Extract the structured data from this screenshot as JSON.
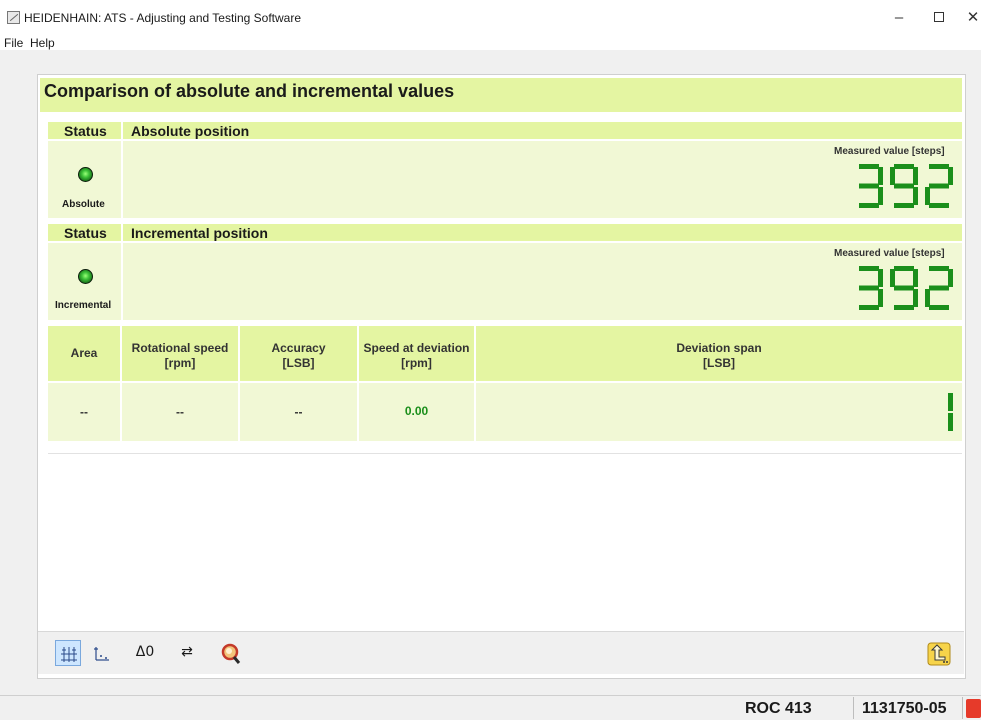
{
  "window": {
    "title": "HEIDENHAIN: ATS - Adjusting and Testing Software",
    "minimize_glyph": "–",
    "close_glyph": "✕"
  },
  "menu": {
    "file": "File",
    "help": "Help"
  },
  "page": {
    "heading": "Comparison of absolute and incremental values"
  },
  "absolute": {
    "status_header": "Status",
    "title": "Absolute position",
    "status_label": "Absolute",
    "measured_label": "Measured value [steps]",
    "value": "392",
    "led_color": "#3fc43a"
  },
  "incremental": {
    "status_header": "Status",
    "title": "Incremental position",
    "status_label": "Incremental",
    "measured_label": "Measured value [steps]",
    "value": "392",
    "led_color": "#3fc43a"
  },
  "table": {
    "columns": [
      {
        "line1": "Area",
        "line2": ""
      },
      {
        "line1": "Rotational speed",
        "line2": "[rpm]"
      },
      {
        "line1": "Accuracy",
        "line2": "[LSB]"
      },
      {
        "line1": "Speed at deviation",
        "line2": "[rpm]"
      },
      {
        "line1": "Deviation span",
        "line2": "[LSB]"
      }
    ],
    "row": {
      "area": "--",
      "rotational_speed": "--",
      "accuracy": "--",
      "speed_at_deviation": "0.00",
      "deviation_span": "1"
    }
  },
  "toolbar": {
    "buttons": [
      {
        "icon": "grid-view-icon",
        "glyph": "⌗",
        "active": true
      },
      {
        "icon": "axis-chart-icon",
        "glyph": "∟",
        "active": false
      },
      {
        "icon": "delta-zero-icon",
        "glyph": "Δ0",
        "active": false
      },
      {
        "icon": "exchange-arrows-icon",
        "glyph": "⇄",
        "active": false
      },
      {
        "icon": "magnifier-search-icon",
        "glyph": "",
        "active": false
      },
      {
        "icon": "return-arrow-icon",
        "glyph": "",
        "active": false
      }
    ]
  },
  "statusbar": {
    "device": "ROC 413",
    "id": "1131750-05"
  },
  "colors": {
    "panel_header": "#e4f5a2",
    "panel_body": "#f1f8d5",
    "segment_on": "#1b8f1b",
    "value_green": "#1b8f1b"
  }
}
